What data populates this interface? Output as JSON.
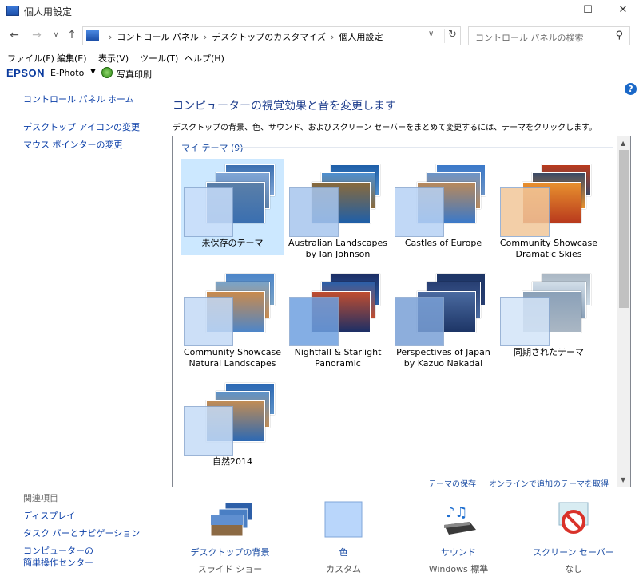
{
  "window": {
    "title": "個人用設定",
    "min": "—",
    "max": "☐",
    "close": "✕"
  },
  "address": {
    "crumbs": [
      "コントロール パネル",
      "デスクトップのカスタマイズ",
      "個人用設定"
    ],
    "search_placeholder": "コントロール パネルの検索"
  },
  "menu": [
    "ファイル(F)",
    "編集(E)",
    "表示(V)",
    "ツール(T)",
    "ヘルプ(H)"
  ],
  "epson": {
    "logo": "EPSON",
    "product": "E-Photo",
    "print": "写真印刷"
  },
  "left": {
    "home": "コントロール パネル ホーム",
    "links": [
      "デスクトップ アイコンの変更",
      "マウス ポインターの変更"
    ],
    "related_heading": "関連項目",
    "related": [
      "ディスプレイ",
      "タスク バーとナビゲーション",
      "コンピューターの",
      "簡単操作センター"
    ]
  },
  "main": {
    "heading": "コンピューターの視覚効果と音を変更します",
    "description": "デスクトップの背景、色、サウンド、およびスクリーン セーバーをまとめて変更するには、テーマをクリックします。",
    "group_label": "マイ テーマ (9)",
    "themes": [
      {
        "name": "未保存のテーマ",
        "swatch": "#c9defa",
        "colors": [
          "#3a6fb0",
          "#7fa5d6",
          "#5b7fa8"
        ]
      },
      {
        "name": "Australian Landscapes\nby Ian Johnson",
        "swatch": "#a8c6ee",
        "colors": [
          "#1f5fa8",
          "#4e8fcf",
          "#8a6a3a"
        ]
      },
      {
        "name": "Castles of Europe",
        "swatch": "#b7d2f5",
        "colors": [
          "#3b79c9",
          "#6c94c8",
          "#b9895a"
        ]
      },
      {
        "name": "Community Showcase\nDramatic Skies",
        "swatch": "#f2c79a",
        "colors": [
          "#b93a1d",
          "#3a4a66",
          "#e8912e"
        ]
      },
      {
        "name": "Community Showcase\nNatural Landscapes",
        "swatch": "#c4daf6",
        "colors": [
          "#4d86c9",
          "#7aa3c7",
          "#c98a4d"
        ]
      },
      {
        "name": "Nightfall & Starlight\nPanoramic",
        "swatch": "#6fa0e0",
        "colors": [
          "#1c2f66",
          "#2c5fa8",
          "#c04d2f"
        ]
      },
      {
        "name": "Perspectives of Japan\nby Kazuo Nakadai",
        "swatch": "#7aa0d6",
        "colors": [
          "#1d3566",
          "#283f73",
          "#4a6aa0"
        ]
      },
      {
        "name": "同期されたテーマ",
        "swatch": "#d3e4f8",
        "colors": [
          "#aab7c4",
          "#d1dde8",
          "#8aa0b8"
        ]
      },
      {
        "name": "自然2014",
        "swatch": "#c6dcf7",
        "colors": [
          "#2c69b4",
          "#5d92c9",
          "#c08c55"
        ]
      }
    ],
    "save_theme": "テーマの保存",
    "get_more": "オンラインで追加のテーマを取得"
  },
  "bottom": [
    {
      "label": "デスクトップの背景",
      "sub": "スライド ショー",
      "icon": "desktop-background-icon"
    },
    {
      "label": "色",
      "sub": "カスタム",
      "icon": "color-icon"
    },
    {
      "label": "サウンド",
      "sub": "Windows 標準",
      "icon": "sound-icon"
    },
    {
      "label": "スクリーン セーバー",
      "sub": "なし",
      "icon": "screensaver-icon"
    }
  ]
}
